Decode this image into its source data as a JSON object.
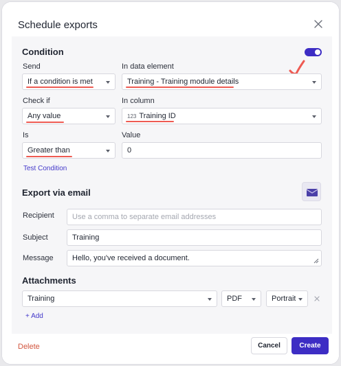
{
  "dialog": {
    "title": "Schedule exports"
  },
  "condition": {
    "section_title": "Condition",
    "enabled": true,
    "send_label": "Send",
    "send_value": "If a condition is met",
    "data_element_label": "In data element",
    "data_element_value": "Training - Training module details",
    "check_if_label": "Check if",
    "check_if_value": "Any value",
    "column_label": "In column",
    "column_type_prefix": "123",
    "column_value": "Training ID",
    "is_label": "Is",
    "is_value": "Greater than",
    "value_label": "Value",
    "value_value": "0",
    "test_link": "Test Condition"
  },
  "email": {
    "section_title": "Export via email",
    "recipient_label": "Recipient",
    "recipient_placeholder": "Use a comma to separate email addresses",
    "subject_label": "Subject",
    "subject_value": "Training",
    "message_label": "Message",
    "message_value": "Hello, you've received a document."
  },
  "attachments": {
    "section_title": "Attachments",
    "items": [
      {
        "name": "Training",
        "format": "PDF",
        "orientation": "Portrait"
      }
    ],
    "add_label": "+ Add"
  },
  "footer": {
    "delete_label": "Delete",
    "cancel_label": "Cancel",
    "create_label": "Create"
  },
  "colors": {
    "accent": "#3d2dc4",
    "annotation": "#ee5a52",
    "delete": "#d2553e"
  }
}
